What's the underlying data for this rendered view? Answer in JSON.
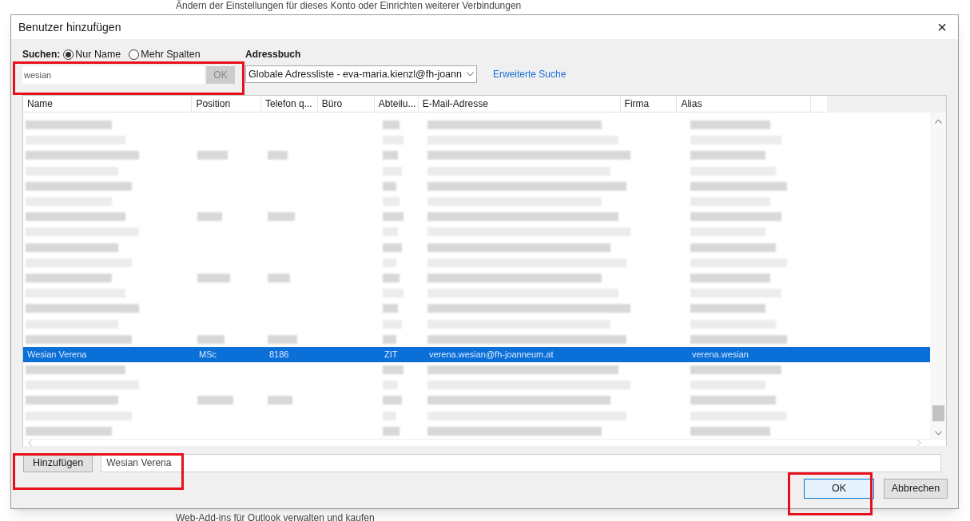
{
  "background": {
    "top_text": "Ändern der Einstellungen für dieses Konto oder Einrichten weiterer Verbindungen",
    "bottom_text": "Web-Add-ins für Outlook verwalten und kaufen"
  },
  "window": {
    "title": "Benutzer hinzufügen",
    "close": "×"
  },
  "search": {
    "label": "Suchen:",
    "options": [
      {
        "label": "Nur Name",
        "selected": true
      },
      {
        "label": "Mehr Spalten",
        "selected": false
      }
    ],
    "value": "wesian",
    "button": "OK"
  },
  "address_book": {
    "label": "Adressbuch",
    "value": "Globale Adressliste - eva-maria.kienzl@fh-joann",
    "link": "Erweiterte Suche"
  },
  "table": {
    "columns": [
      "Name",
      "Position",
      "Telefon q...",
      "Büro",
      "Abteilu...",
      "E-Mail-Adresse",
      "Firma",
      "Alias"
    ],
    "rows": [
      {
        "kind": "redacted",
        "selected": false
      },
      {
        "kind": "redacted",
        "selected": false
      },
      {
        "kind": "redacted",
        "selected": false
      },
      {
        "kind": "redacted",
        "selected": false
      },
      {
        "kind": "redacted",
        "selected": false
      },
      {
        "kind": "redacted",
        "selected": false
      },
      {
        "kind": "redacted",
        "selected": false
      },
      {
        "kind": "redacted",
        "selected": false
      },
      {
        "kind": "redacted",
        "selected": false
      },
      {
        "kind": "redacted",
        "selected": false
      },
      {
        "kind": "redacted",
        "selected": false
      },
      {
        "kind": "redacted",
        "selected": false
      },
      {
        "kind": "redacted",
        "selected": false
      },
      {
        "kind": "redacted",
        "selected": false
      },
      {
        "kind": "redacted",
        "selected": false
      },
      {
        "kind": "entry",
        "selected": true,
        "cells": [
          "Wesian Verena",
          "MSc",
          "8186",
          "",
          "ZIT",
          "verena.wesian@fh-joanneum.at",
          "",
          "verena.wesian"
        ]
      },
      {
        "kind": "redacted",
        "selected": false
      },
      {
        "kind": "redacted",
        "selected": false
      },
      {
        "kind": "redacted",
        "selected": false
      },
      {
        "kind": "redacted",
        "selected": false
      },
      {
        "kind": "redacted",
        "selected": false
      }
    ]
  },
  "add": {
    "button": "Hinzufügen",
    "value": "Wesian Verena"
  },
  "buttons": [
    {
      "label": "OK",
      "default": true
    },
    {
      "label": "Abbrechen",
      "default": false
    }
  ]
}
